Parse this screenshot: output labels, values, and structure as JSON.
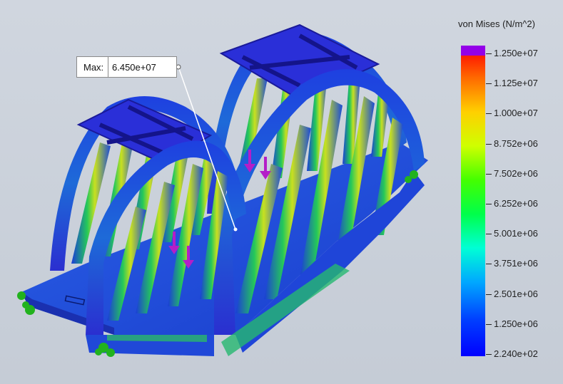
{
  "legend": {
    "title": "von Mises (N/m^2)",
    "labels": [
      "1.250e+07",
      "1.125e+07",
      "1.000e+07",
      "8.752e+06",
      "7.502e+06",
      "6.252e+06",
      "5.001e+06",
      "3.751e+06",
      "2.501e+06",
      "1.250e+06",
      "2.240e+02"
    ],
    "over_limit_color": "#9400e8"
  },
  "max_annotation": {
    "label": "Max:",
    "value": "6.450e+07"
  },
  "colors": {
    "background": "#c8ced8",
    "low_stress": "#1a3bd6",
    "mid_stress": "#22d34a",
    "high_stress": "#ffd000",
    "fixture": "#22b21e",
    "load_arrow": "#b41ec8"
  }
}
